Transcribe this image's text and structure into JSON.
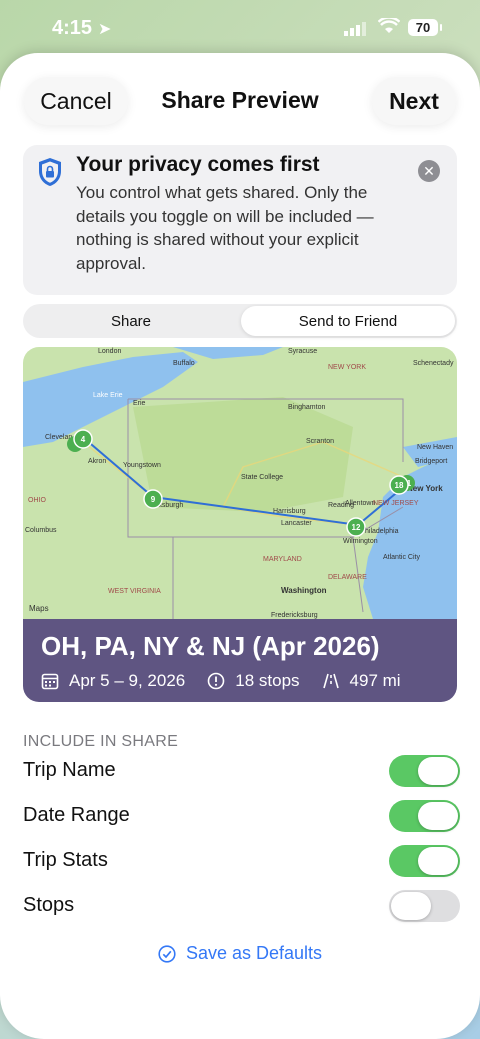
{
  "status": {
    "time": "4:15",
    "battery": "70"
  },
  "nav": {
    "cancel": "Cancel",
    "title": "Share Preview",
    "next": "Next"
  },
  "privacy": {
    "title": "Your privacy comes first",
    "body": "You control what gets shared. Only the details you toggle on will be included — nothing is shared without your explicit approval."
  },
  "segments": {
    "share": "Share",
    "send": "Send to Friend",
    "selected": "Send to Friend"
  },
  "map": {
    "labels": {
      "london": "London",
      "buffalo": "Buffalo",
      "syracuse": "Syracuse",
      "schenectady": "Schenectady",
      "new_york_state": "NEW YORK",
      "erie": "Erie",
      "lake_erie": "Lake Erie",
      "binghamton": "Binghamton",
      "cleveland": "Clevelan",
      "akron": "Akron",
      "youngstown": "Youngstown",
      "scranton": "Scranton",
      "new_haven": "New Haven",
      "bridgeport": "Bridgeport",
      "state_college": "State College",
      "allentown": "Allentown",
      "new_york": "New York",
      "ohio": "OHIO",
      "pittsburgh": "ttsburgh",
      "harrisburg": "Harrisburg",
      "reading": "Reading",
      "new_jersey": "NEW JERSEY",
      "lancaster": "Lancaster",
      "philadelphia": "hiladelphia",
      "columbus": "Columbus",
      "wilmington": "Wilmington",
      "maryland": "MARYLAND",
      "atlantic_city": "Atlantic City",
      "delaware": "DELAWARE",
      "washington": "Washington",
      "west_virginia": "WEST VIRGINIA",
      "fredericksburg": "Fredericksburg",
      "attribution": "Maps",
      "stop_cleveland": "4",
      "stop_pittsburgh": "9",
      "stop_philly": "12",
      "stop_nyc": "18",
      "stop_nyc2": "1"
    }
  },
  "trip": {
    "name": "OH, PA, NY & NJ (Apr 2026)",
    "dates": "Apr 5 – 9, 2026",
    "stops": "18 stops",
    "distance": "497 mi"
  },
  "include": {
    "header": "INCLUDE IN SHARE",
    "items": [
      {
        "label": "Trip Name",
        "on": true
      },
      {
        "label": "Date Range",
        "on": true
      },
      {
        "label": "Trip Stats",
        "on": true
      },
      {
        "label": "Stops",
        "on": false
      }
    ]
  },
  "defaults_label": "Save as Defaults",
  "colors": {
    "accent": "#3478f6",
    "toggle_on": "#5ac864",
    "banner": "#5f5582",
    "route": "#2f6fd6",
    "stop": "#4caf50"
  }
}
